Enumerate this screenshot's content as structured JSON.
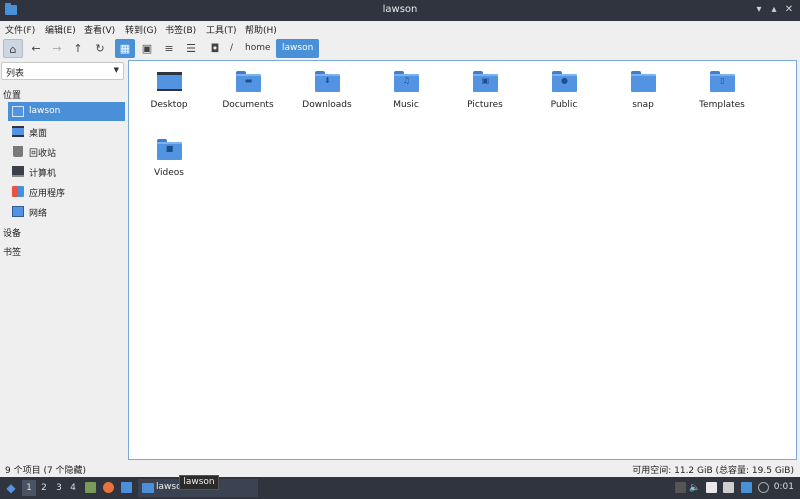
{
  "window": {
    "title": "lawson"
  },
  "menubar": {
    "items": [
      "文件(F)",
      "编辑(E)",
      "查看(V)",
      "转到(G)",
      "书签(B)",
      "工具(T)",
      "帮助(H)"
    ]
  },
  "toolbar": {
    "path": [
      "home",
      "lawson"
    ],
    "path_separator": "/"
  },
  "sidebar": {
    "view_mode": "列表",
    "sections": {
      "places": "位置",
      "devices": "设备",
      "bookmarks": "书签"
    },
    "places": [
      {
        "label": "lawson",
        "icon": "home-folder-icon"
      },
      {
        "label": "桌面",
        "icon": "desktop-icon"
      },
      {
        "label": "回收站",
        "icon": "trash-icon"
      },
      {
        "label": "计算机",
        "icon": "computer-icon"
      },
      {
        "label": "应用程序",
        "icon": "applications-icon"
      },
      {
        "label": "网络",
        "icon": "network-icon"
      }
    ]
  },
  "files": [
    {
      "name": "Desktop",
      "icon": "desktop-folder-icon"
    },
    {
      "name": "Documents",
      "icon": "documents-folder-icon"
    },
    {
      "name": "Downloads",
      "icon": "downloads-folder-icon"
    },
    {
      "name": "Music",
      "icon": "music-folder-icon"
    },
    {
      "name": "Pictures",
      "icon": "pictures-folder-icon"
    },
    {
      "name": "Public",
      "icon": "public-folder-icon"
    },
    {
      "name": "snap",
      "icon": "folder-icon"
    },
    {
      "name": "Templates",
      "icon": "templates-folder-icon"
    },
    {
      "name": "Videos",
      "icon": "videos-folder-icon"
    }
  ],
  "statusbar": {
    "items_count": "9 个项目 (7 个隐藏)",
    "free_space": "可用空间: 11.2 GiB (总容量: 19.5 GiB)"
  },
  "taskbar": {
    "workspaces": [
      "1",
      "2",
      "3",
      "4"
    ],
    "active_window": "lawson",
    "tooltip": "lawson",
    "clock": "0:01"
  },
  "colors": {
    "accent": "#4a90d9",
    "titlebar": "#2f343f",
    "folder": "#5294e2"
  }
}
